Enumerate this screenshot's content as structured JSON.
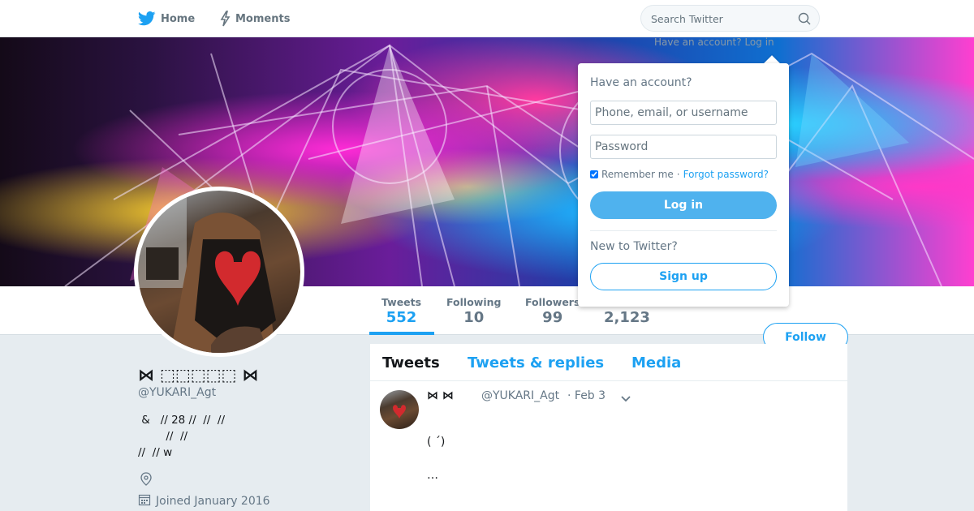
{
  "nav": {
    "home_label": "Home",
    "moments_label": "Moments",
    "search_placeholder": "Search Twitter"
  },
  "login_dropdown": {
    "link_text": "Have an account? Log in",
    "heading": "Have an account?",
    "username_placeholder": "Phone, email, or username",
    "password_placeholder": "Password",
    "remember_label": "Remember me",
    "separator": "·",
    "forgot_label": "Forgot password?",
    "login_label": "Log in",
    "new_heading": "New to Twitter?",
    "signup_label": "Sign up"
  },
  "profile_nav": {
    "stats": [
      {
        "label": "Tweets",
        "value": "552"
      },
      {
        "label": "Following",
        "value": "10"
      },
      {
        "label": "Followers",
        "value": "99"
      },
      {
        "label": "",
        "value": "2,123"
      }
    ],
    "follow_label": "Follow"
  },
  "profile": {
    "display_name": "⋈ ⬚⬚⬚⬚⬚ ⋈",
    "handle": "@YUKARI_Agt",
    "bio": " &   // 28 //  //  //\n        //  //\n//  // w",
    "joined": "Joined January 2016"
  },
  "timeline": {
    "tabs": [
      "Tweets",
      "Tweets & replies",
      "Media"
    ],
    "tweet": {
      "name": "⋈  ⋈",
      "handle": "@YUKARI_Agt",
      "time": "· Feb 3",
      "lines": [
        "( ´)",
        "…"
      ]
    }
  },
  "colors": {
    "accent": "#1da1f2",
    "background": "#e6ecf0",
    "muted": "#657786"
  }
}
